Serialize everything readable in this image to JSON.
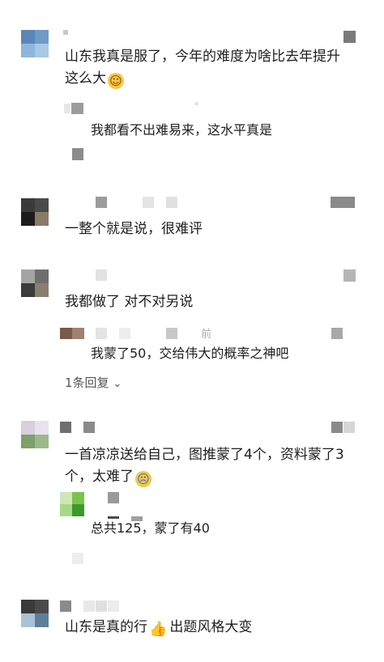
{
  "comments": [
    {
      "text_line1": "山东我真是服了，今年的难度为啥比去年提升",
      "text_line2": "这么大",
      "emoji": "flushed-face-icon",
      "reply": {
        "text": "我都看不出难易来，这水平真是"
      }
    },
    {
      "text": "一整个就是说，很难评"
    },
    {
      "text": "我都做了   对不对另说",
      "reply": {
        "time": "前",
        "text": "我蒙了50，交给伟大的概率之神吧"
      },
      "more_replies": "1条回复",
      "more_icon": "chevron-down-icon"
    },
    {
      "text_line1": "一首凉凉送给自己，图推蒙了4个，资料蒙了3",
      "text_line2": "个，太难了",
      "emoji": "crying-face-icon",
      "reply": {
        "text": "总共125，蒙了有40"
      }
    },
    {
      "text": "山东是真的行",
      "emoji": "thumbs-up-icon",
      "text_tail": " 出题风格大变"
    }
  ],
  "colors": {
    "text": "#1e1e1e",
    "muted": "#555555",
    "placeholder_gray": "#8a8a8a",
    "emoji_yellow": "#f6c744"
  }
}
